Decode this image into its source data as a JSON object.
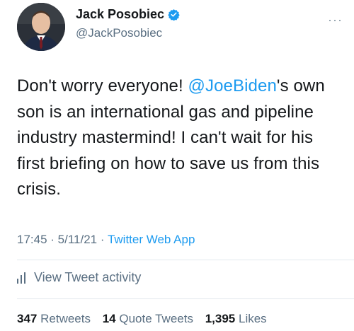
{
  "author": {
    "name": "Jack Posobiec",
    "handle": "@JackPosobiec",
    "verified": true
  },
  "more_glyph": "···",
  "tweet": {
    "text_before": "Don't worry everyone! ",
    "mention": "@JoeBiden",
    "text_after": "'s own son is an international gas and pipeline industry mastermind! I can't wait for his first briefing on how to save us from this crisis."
  },
  "meta": {
    "time": "17:45",
    "sep1": " · ",
    "date": "5/11/21",
    "sep2": " · ",
    "app": "Twitter Web App"
  },
  "activity": {
    "label": "View Tweet activity"
  },
  "stats": {
    "retweets_count": "347",
    "retweets_label": "Retweets",
    "quotes_count": "14",
    "quotes_label": "Quote Tweets",
    "likes_count": "1,395",
    "likes_label": "Likes"
  },
  "colors": {
    "accent": "#1d9bf0",
    "muted": "#5b7083",
    "text": "#14171a"
  }
}
